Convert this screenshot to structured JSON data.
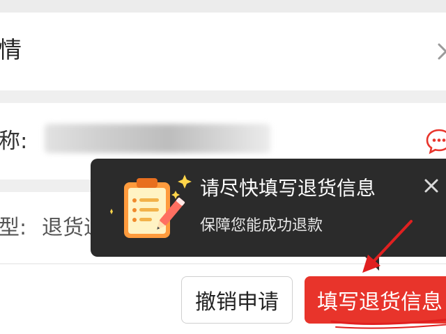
{
  "header": {
    "title": "情",
    "close_icon": "close-icon"
  },
  "shop": {
    "label": "称:",
    "chat_icon": "chat-bubble-icon"
  },
  "refund": {
    "type_label": "型:",
    "type_value": "退货退款"
  },
  "tooltip": {
    "title": "请尽快填写退货信息",
    "subtitle": "保障您能成功退款",
    "illustration_icon": "clipboard-pencil-icon",
    "close_icon": "close-icon"
  },
  "actions": {
    "cancel_label": "撤销申请",
    "fill_label": "填写退货信息"
  },
  "colors": {
    "primary": "#e8342b",
    "tooltip_bg": "#2b2b2b",
    "annotation": "#e02020"
  }
}
